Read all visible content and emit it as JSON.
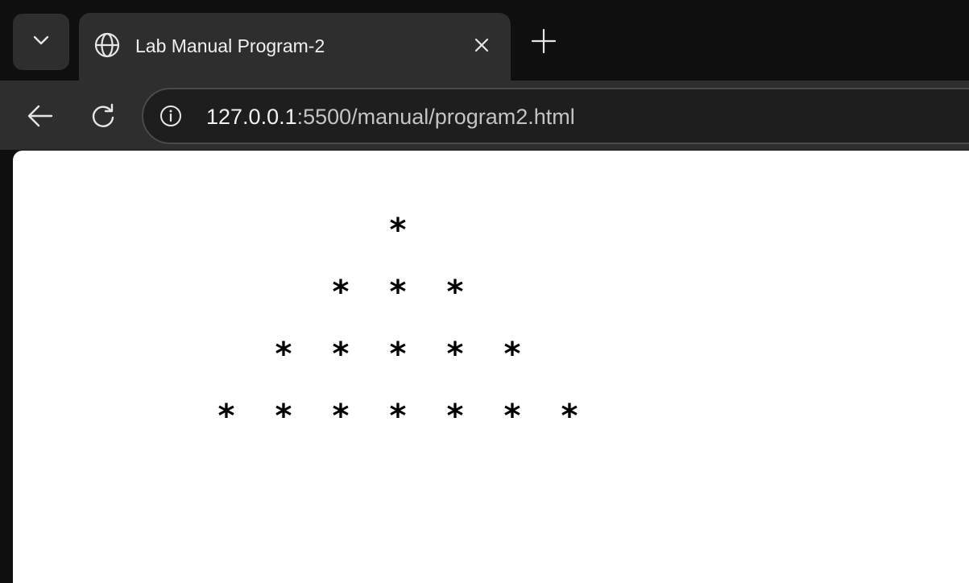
{
  "browser": {
    "tab_search_icon": "chevron-down-icon",
    "tab": {
      "favicon": "globe-icon",
      "title": "Lab Manual Program-2",
      "close_icon": "close-icon"
    },
    "new_tab_icon": "plus-icon",
    "toolbar": {
      "back_icon": "arrow-left-icon",
      "reload_icon": "reload-icon",
      "site_info_icon": "info-icon",
      "url_host": "127.0.0.1",
      "url_rest": ":5500/manual/program2.html"
    }
  },
  "page": {
    "pyramid": {
      "symbol": "*",
      "rows": [
        1,
        3,
        5,
        7
      ]
    }
  }
}
